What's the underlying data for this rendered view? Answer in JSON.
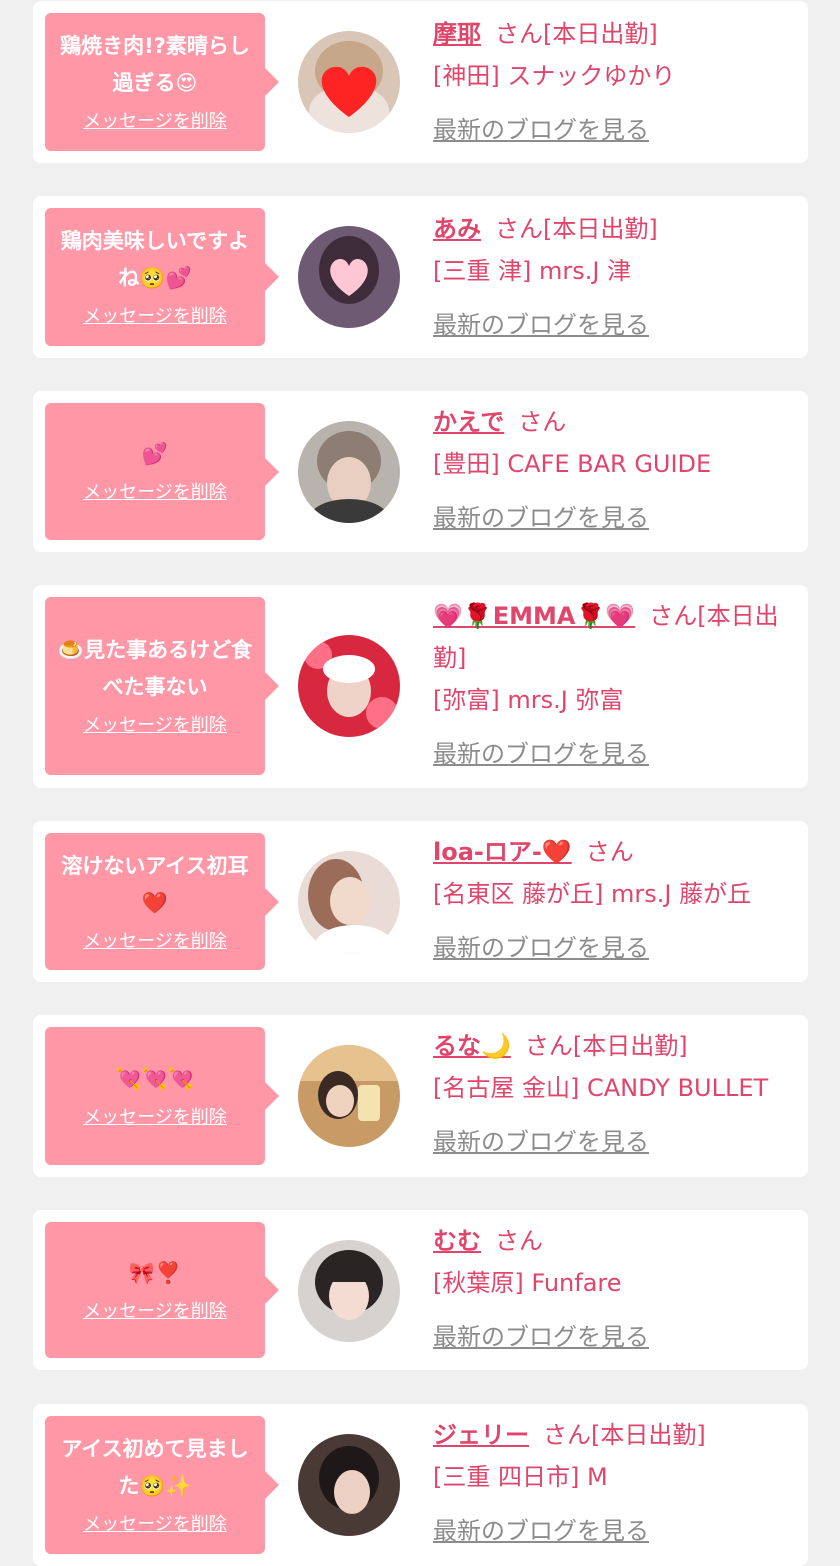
{
  "delete_label": "メッセージを削除",
  "blog_label": "最新のブログを見る",
  "colors": {
    "page_bg": "#f0f0f0",
    "card_bg": "#ffffff",
    "bubble_bg": "#ff97a7",
    "name_color": "#e0466b",
    "link_gray": "#8c8c8c"
  },
  "cards": [
    {
      "message": "鶏焼き肉!?素晴らし過ぎる😍",
      "name": "摩耶",
      "suffix": "さん[本日出勤]",
      "shop": "[神田] スナックゆかり",
      "avatar_icon": "heart-sticker-avatar"
    },
    {
      "message": "鶏肉美味しいですよね🥺💕",
      "name": "あみ",
      "suffix": "さん[本日出勤]",
      "shop": "[三重 津] mrs.J 津",
      "avatar_icon": "heart-sticker-avatar"
    },
    {
      "message": "💕",
      "name": "かえで",
      "suffix": "さん",
      "shop": "[豊田] CAFE BAR GUIDE",
      "avatar_icon": "portrait-avatar"
    },
    {
      "message": "🍮見た事あるけど食べた事ない",
      "name": "💗🌹EMMA🌹💗",
      "suffix": "さん[本日出勤]",
      "shop": "[弥富] mrs.J 弥富",
      "avatar_icon": "portrait-avatar"
    },
    {
      "message": "溶けないアイス初耳❤️",
      "name": "loa-ロア-❤️",
      "suffix": "さん",
      "shop": "[名東区 藤が丘] mrs.J 藤が丘",
      "avatar_icon": "portrait-avatar"
    },
    {
      "message": "💘💘💘",
      "name": "るな🌙",
      "suffix": "さん[本日出勤]",
      "shop": "[名古屋 金山] CANDY BULLET",
      "avatar_icon": "portrait-avatar"
    },
    {
      "message": "🎀❣️",
      "name": "むむ",
      "suffix": "さん",
      "shop": "[秋葉原] Funfare",
      "avatar_icon": "portrait-avatar"
    },
    {
      "message": "アイス初めて見ました🥺✨",
      "name": "ジェリー",
      "suffix": "さん[本日出勤]",
      "shop": "[三重 四日市] M",
      "avatar_icon": "portrait-avatar"
    }
  ]
}
